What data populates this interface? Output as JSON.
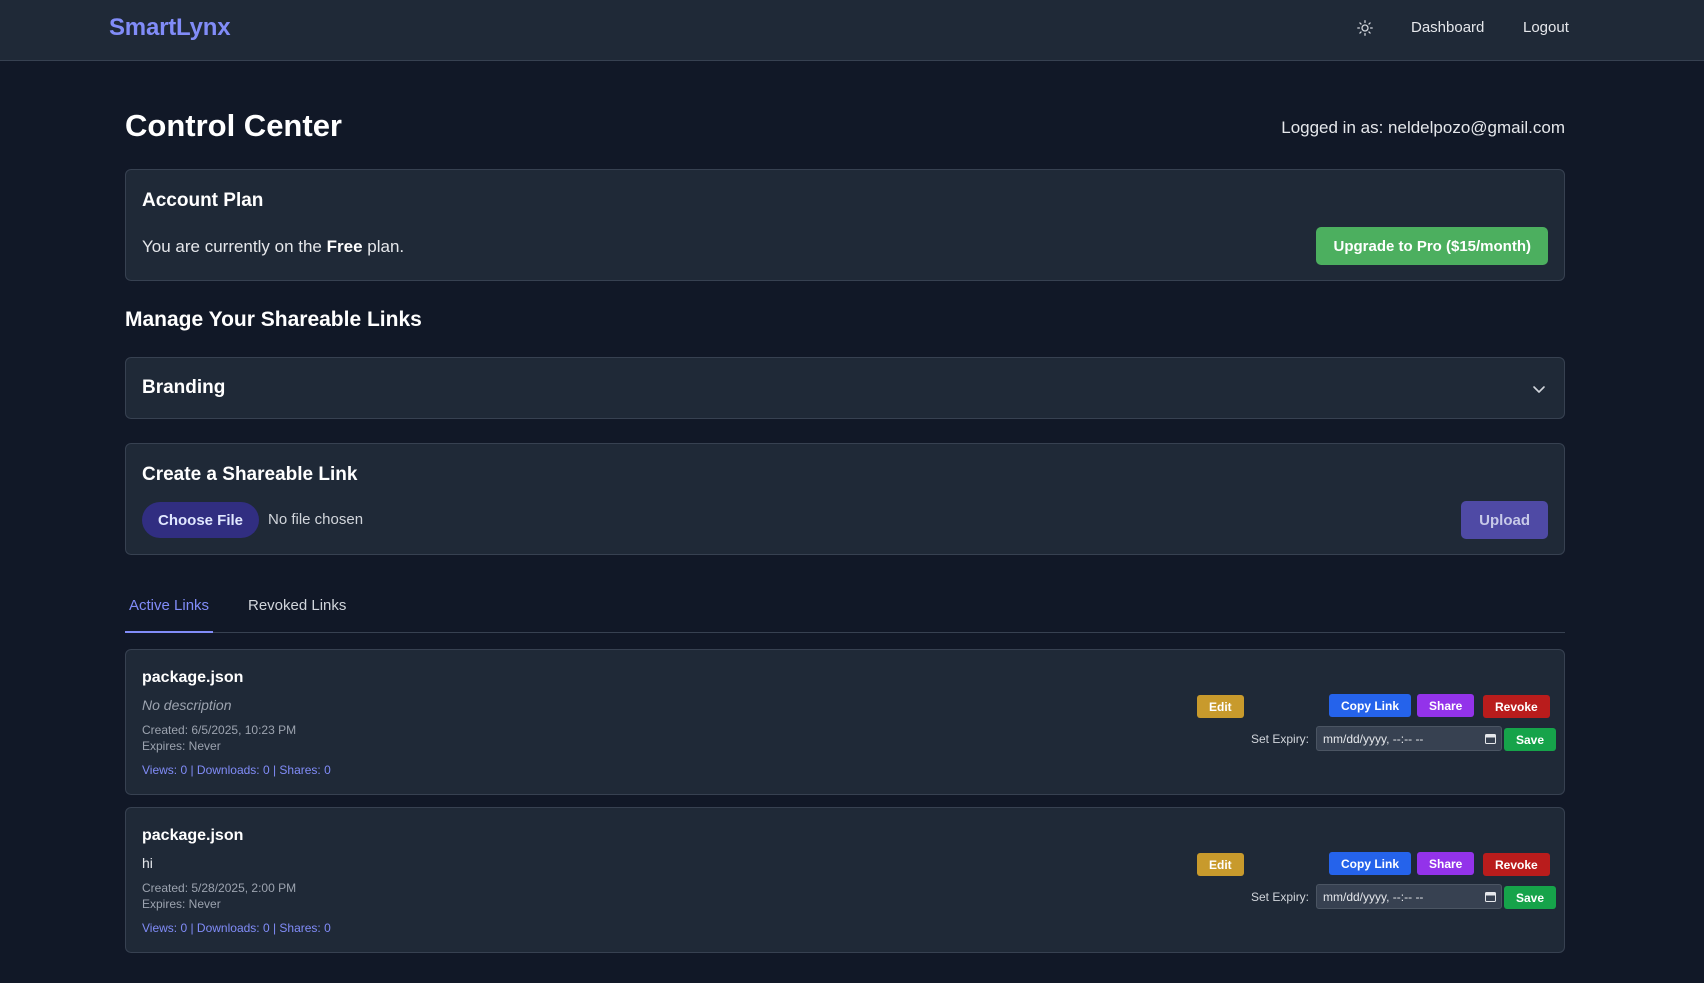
{
  "header": {
    "brand": "SmartLynx",
    "nav": {
      "dashboard": "Dashboard",
      "logout": "Logout"
    },
    "theme_icon": "sun-icon"
  },
  "page": {
    "title": "Control Center",
    "logged_in": "Logged in as: neldelpozo@gmail.com"
  },
  "plan": {
    "title": "Account Plan",
    "text_before": "You are currently on the ",
    "plan_name": "Free",
    "text_after": " plan.",
    "upgrade_label": "Upgrade to Pro ($15/month)",
    "upgrade_color": "#4caf5f"
  },
  "manage": {
    "title": "Manage Your Shareable Links"
  },
  "branding": {
    "title": "Branding",
    "icon": "chevron-down-icon"
  },
  "create": {
    "title": "Create a Shareable Link",
    "choose_label": "Choose File",
    "no_file": "No file chosen",
    "upload_label": "Upload"
  },
  "tabs": [
    {
      "label": "Active Links",
      "active": true
    },
    {
      "label": "Revoked Links",
      "active": false
    }
  ],
  "links": [
    {
      "name": "package.json",
      "description": "No description",
      "created": "Created: 6/5/2025, 10:23 PM",
      "expires": "Expires: Never",
      "stats": "Views: 0 | Downloads: 0 | Shares: 0",
      "edit": "Edit",
      "copy": "Copy Link",
      "share": "Share",
      "revoke": "Revoke",
      "expiry_label": "Set Expiry:",
      "expiry_placeholder": "mm/dd/yyyy, --:-- --",
      "save": "Save"
    },
    {
      "name": "package.json",
      "description": "hi",
      "created": "Created: 5/28/2025, 2:00 PM",
      "expires": "Expires: Never",
      "stats": "Views: 0 | Downloads: 0 | Shares: 0",
      "edit": "Edit",
      "copy": "Copy Link",
      "share": "Share",
      "revoke": "Revoke",
      "expiry_label": "Set Expiry:",
      "expiry_placeholder": "mm/dd/yyyy, --:-- --",
      "save": "Save"
    }
  ],
  "colors": {
    "background": "#111827",
    "surface": "#1f2937",
    "accent": "#818cf8"
  }
}
